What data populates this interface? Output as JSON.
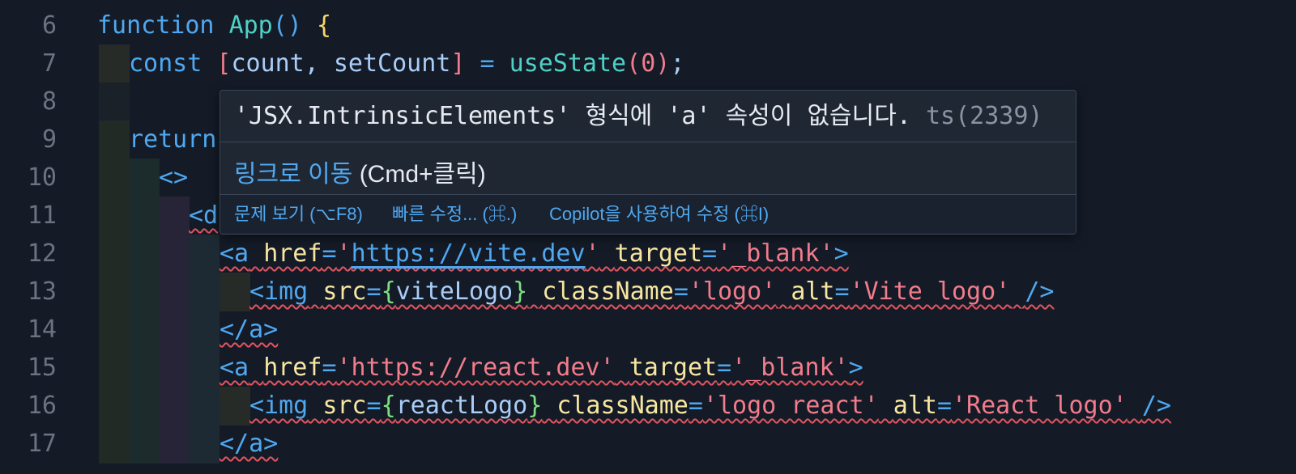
{
  "lines": [
    {
      "n": "6"
    },
    {
      "n": "7"
    },
    {
      "n": "8"
    },
    {
      "n": "9"
    },
    {
      "n": "10"
    },
    {
      "n": "11"
    },
    {
      "n": "12"
    },
    {
      "n": "13"
    },
    {
      "n": "14"
    },
    {
      "n": "15"
    },
    {
      "n": "16"
    },
    {
      "n": "17"
    }
  ],
  "code": {
    "l6": {
      "kw": "function",
      "name": "App",
      "paren": "()",
      "brace": "{"
    },
    "l7": {
      "kw": "const",
      "lb": "[",
      "a": "count",
      "comma": ",",
      "b": "setCount",
      "rb": "]",
      "eq": "=",
      "fn": "useState",
      "lp": "(",
      "num": "0",
      "rp": ")",
      "semi": ";"
    },
    "l9": {
      "kw": "return"
    },
    "l10": {
      "frag": "<>"
    },
    "l11": {
      "partial": "<d"
    },
    "l12": {
      "open": "<a",
      "href": "href",
      "eq1": "=",
      "q1": "'",
      "url": "https://vite.dev",
      "q2": "'",
      "target": "target",
      "eq2": "=",
      "tv": "'_blank'",
      "close": ">"
    },
    "l13": {
      "open": "<img",
      "src": "src",
      "eq1": "=",
      "lb": "{",
      "var": "viteLogo",
      "rb": "}",
      "cls": "className",
      "eq2": "=",
      "clsv": "'logo'",
      "alt": "alt",
      "eq3": "=",
      "altv": "'Vite logo'",
      "close": "/>"
    },
    "l14": {
      "close": "</a>"
    },
    "l15": {
      "open": "<a",
      "href": "href",
      "eq1": "=",
      "url": "'https://react.dev'",
      "target": "target",
      "eq2": "=",
      "tv": "'_blank'",
      "close": ">"
    },
    "l16": {
      "open": "<img",
      "src": "src",
      "eq1": "=",
      "lb": "{",
      "var": "reactLogo",
      "rb": "}",
      "cls": "className",
      "eq2": "=",
      "clsv": "'logo react'",
      "alt": "alt",
      "eq3": "=",
      "altv": "'React logo'",
      "close": "/>"
    },
    "l17": {
      "close": "</a>"
    }
  },
  "hover": {
    "message": "'JSX.IntrinsicElements' 형식에 'a' 속성이 없습니다.",
    "code": "ts(2339)",
    "link_text": "링크로 이동",
    "link_hint": "(Cmd+클릭)",
    "actions": [
      {
        "label": "문제 보기 (⌥F8)"
      },
      {
        "label": "빠른 수정... (⌘.)"
      },
      {
        "label": "Copilot을 사용하여 수정 (⌘I)"
      }
    ]
  },
  "colors": {
    "background": "#141b27",
    "keyword": "#4fa8f0",
    "function": "#4fd1c5",
    "string": "#f27c8c",
    "attribute": "#f8e7a0",
    "error_squiggle": "#e05561"
  }
}
